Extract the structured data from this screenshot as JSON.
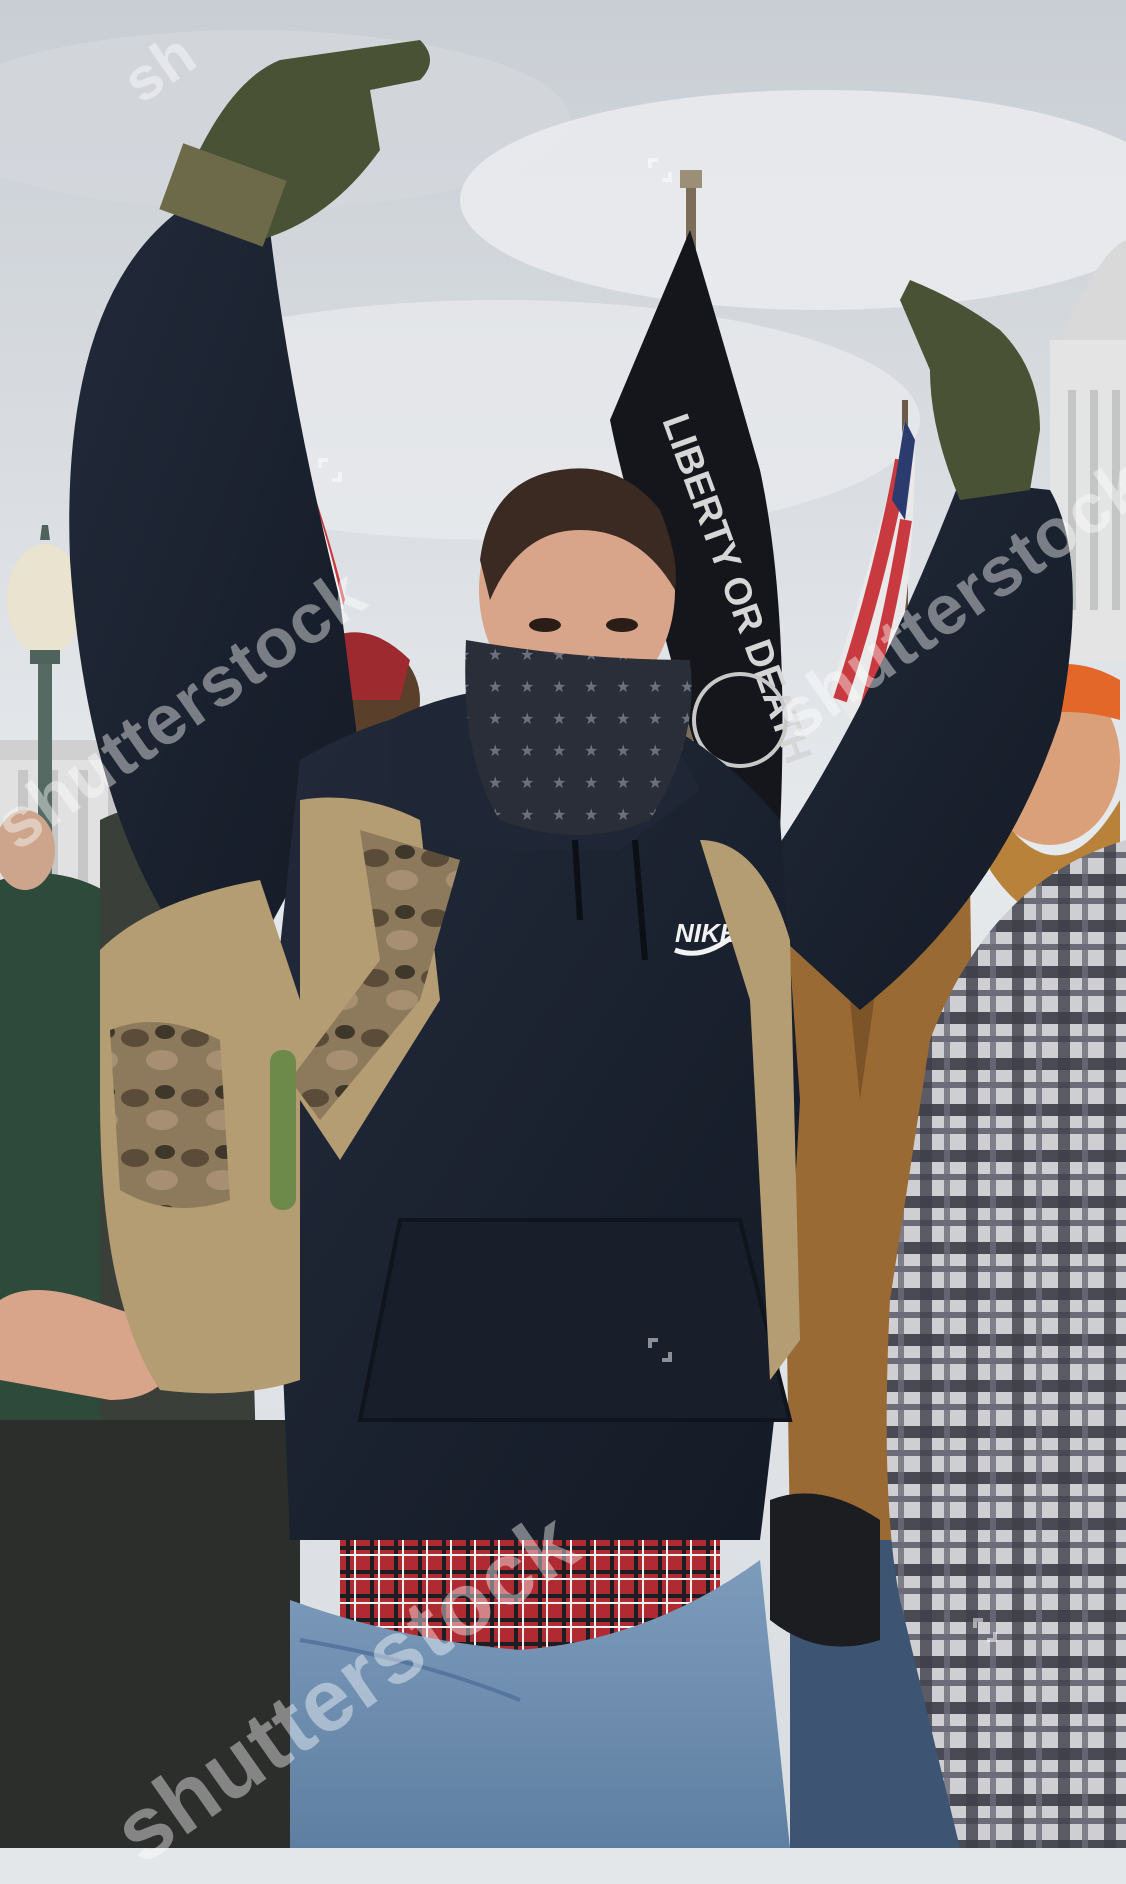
{
  "photo": {
    "subject": "crowd-scene",
    "colors": {
      "sky": "#dfe3e7",
      "hoodie": "#1b2230",
      "glove": "#4a5236",
      "jeans": "#6f8fb0",
      "flannel": "#b02a32",
      "backpack": "#b49c73",
      "jacket": "#9a6a35",
      "orange_cap": "#e4672a"
    }
  },
  "garment_logo": "NIKE",
  "flag_text": "LIBERTY OR DEATH",
  "watermark": {
    "text": "shutterstock",
    "top_text": "sh"
  }
}
